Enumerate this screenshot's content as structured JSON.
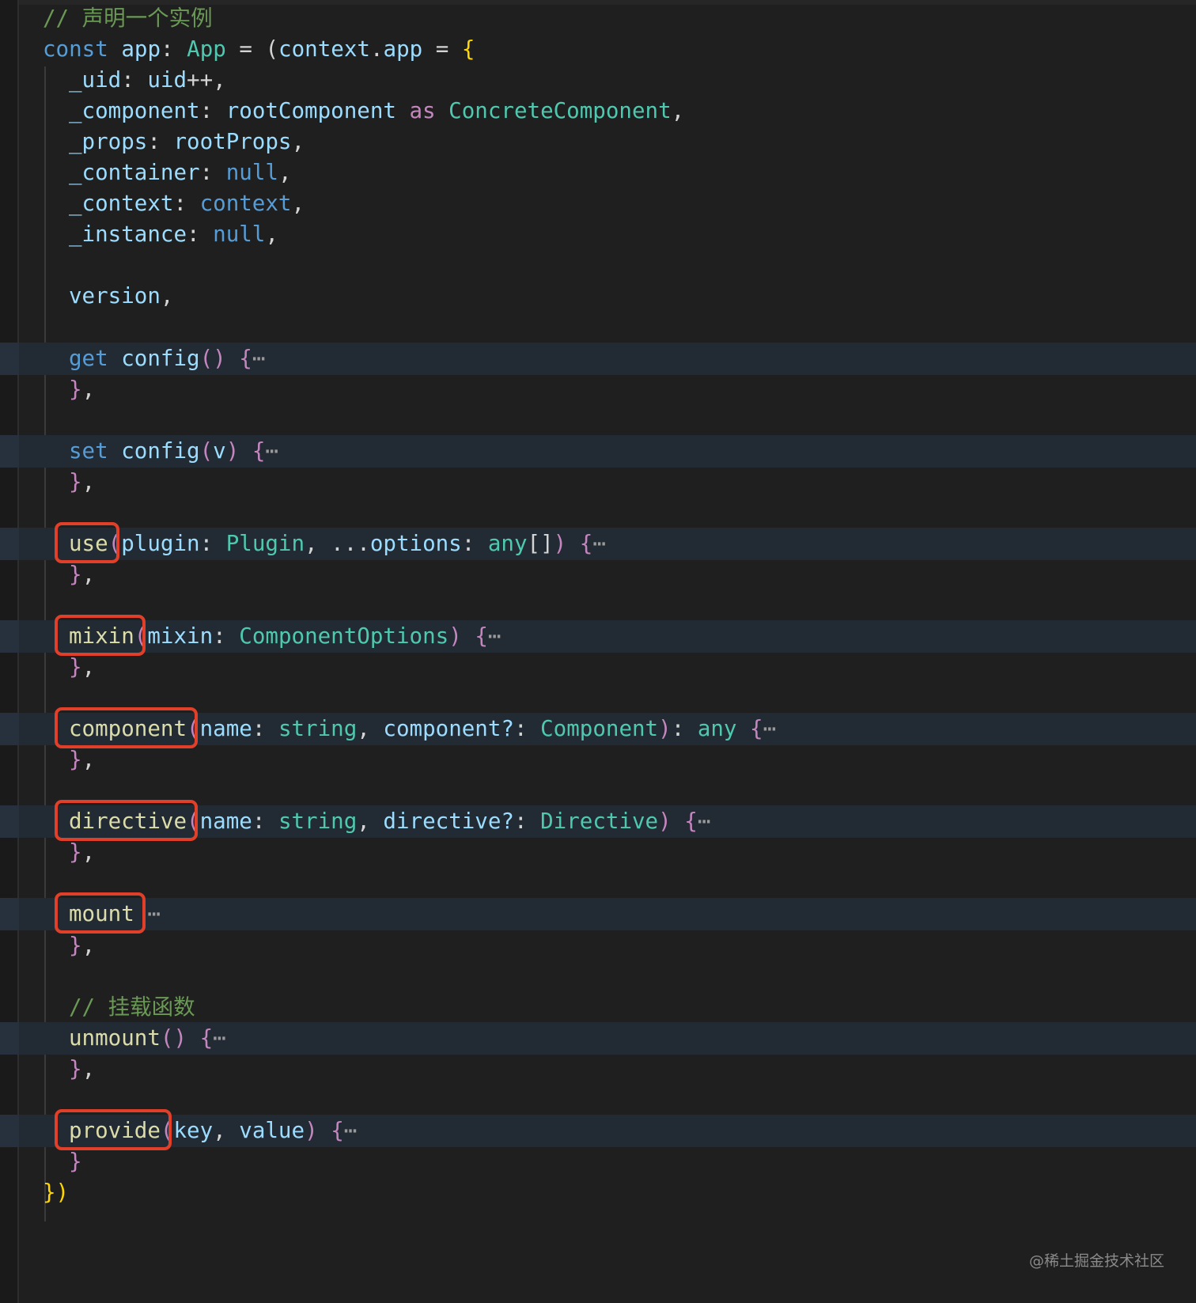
{
  "editor": {
    "lines": [
      {
        "highlight": false,
        "indent": 0,
        "tokens": [
          {
            "t": "// 声明一个实例",
            "c": "cm"
          }
        ]
      },
      {
        "highlight": false,
        "indent": 0,
        "tokens": [
          {
            "t": "const ",
            "c": "kw"
          },
          {
            "t": "app",
            "c": "var"
          },
          {
            "t": ": ",
            "c": "pl"
          },
          {
            "t": "App",
            "c": "ty"
          },
          {
            "t": " = ",
            "c": "pl"
          },
          {
            "t": "(",
            "c": "pl"
          },
          {
            "t": "context",
            "c": "var"
          },
          {
            "t": ".",
            "c": "pl"
          },
          {
            "t": "app",
            "c": "var"
          },
          {
            "t": " = ",
            "c": "pl"
          },
          {
            "t": "{",
            "c": "br"
          }
        ]
      },
      {
        "highlight": false,
        "indent": 1,
        "tokens": [
          {
            "t": "_uid",
            "c": "var"
          },
          {
            "t": ": ",
            "c": "pl"
          },
          {
            "t": "uid",
            "c": "var"
          },
          {
            "t": "++,",
            "c": "pl"
          }
        ]
      },
      {
        "highlight": false,
        "indent": 1,
        "tokens": [
          {
            "t": "_component",
            "c": "var"
          },
          {
            "t": ": ",
            "c": "pl"
          },
          {
            "t": "rootComponent",
            "c": "var"
          },
          {
            "t": " as ",
            "c": "pk"
          },
          {
            "t": "ConcreteComponent",
            "c": "ty"
          },
          {
            "t": ",",
            "c": "pl"
          }
        ]
      },
      {
        "highlight": false,
        "indent": 1,
        "tokens": [
          {
            "t": "_props",
            "c": "var"
          },
          {
            "t": ": ",
            "c": "pl"
          },
          {
            "t": "rootProps",
            "c": "var"
          },
          {
            "t": ",",
            "c": "pl"
          }
        ]
      },
      {
        "highlight": false,
        "indent": 1,
        "tokens": [
          {
            "t": "_container",
            "c": "var"
          },
          {
            "t": ": ",
            "c": "pl"
          },
          {
            "t": "null",
            "c": "kw"
          },
          {
            "t": ",",
            "c": "pl"
          }
        ]
      },
      {
        "highlight": false,
        "indent": 1,
        "tokens": [
          {
            "t": "_context",
            "c": "var"
          },
          {
            "t": ": ",
            "c": "pl"
          },
          {
            "t": "context",
            "c": "kw"
          },
          {
            "t": ",",
            "c": "pl"
          }
        ]
      },
      {
        "highlight": false,
        "indent": 1,
        "tokens": [
          {
            "t": "_instance",
            "c": "var"
          },
          {
            "t": ": ",
            "c": "pl"
          },
          {
            "t": "null",
            "c": "kw"
          },
          {
            "t": ",",
            "c": "pl"
          }
        ]
      },
      {
        "highlight": false,
        "indent": 1,
        "tokens": []
      },
      {
        "highlight": false,
        "indent": 1,
        "tokens": [
          {
            "t": "version",
            "c": "var"
          },
          {
            "t": ",",
            "c": "pl"
          }
        ]
      },
      {
        "highlight": false,
        "indent": 1,
        "tokens": []
      },
      {
        "highlight": true,
        "indent": 1,
        "tokens": [
          {
            "t": "get ",
            "c": "kw"
          },
          {
            "t": "config",
            "c": "var"
          },
          {
            "t": "()",
            "c": "pk"
          },
          {
            "t": " ",
            "c": "pl"
          },
          {
            "t": "{",
            "c": "pk"
          },
          {
            "t": "⋯",
            "c": "ellipsis"
          }
        ]
      },
      {
        "highlight": false,
        "indent": 1,
        "tokens": [
          {
            "t": "}",
            "c": "pk"
          },
          {
            "t": ",",
            "c": "pl"
          }
        ]
      },
      {
        "highlight": false,
        "indent": 1,
        "tokens": []
      },
      {
        "highlight": true,
        "indent": 1,
        "tokens": [
          {
            "t": "set ",
            "c": "kw"
          },
          {
            "t": "config",
            "c": "var"
          },
          {
            "t": "(",
            "c": "pk"
          },
          {
            "t": "v",
            "c": "var"
          },
          {
            "t": ")",
            "c": "pk"
          },
          {
            "t": " ",
            "c": "pl"
          },
          {
            "t": "{",
            "c": "pk"
          },
          {
            "t": "⋯",
            "c": "ellipsis"
          }
        ]
      },
      {
        "highlight": false,
        "indent": 1,
        "tokens": [
          {
            "t": "}",
            "c": "pk"
          },
          {
            "t": ",",
            "c": "pl"
          }
        ]
      },
      {
        "highlight": false,
        "indent": 1,
        "tokens": []
      },
      {
        "highlight": true,
        "indent": 1,
        "tokens": [
          {
            "t": "use",
            "c": "fn"
          },
          {
            "t": "(",
            "c": "pk"
          },
          {
            "t": "plugin",
            "c": "var"
          },
          {
            "t": ": ",
            "c": "pl"
          },
          {
            "t": "Plugin",
            "c": "ty"
          },
          {
            "t": ", ",
            "c": "pl"
          },
          {
            "t": "...",
            "c": "pl"
          },
          {
            "t": "options",
            "c": "var"
          },
          {
            "t": ": ",
            "c": "pl"
          },
          {
            "t": "any",
            "c": "ty"
          },
          {
            "t": "[]",
            "c": "pl"
          },
          {
            "t": ")",
            "c": "pk"
          },
          {
            "t": " ",
            "c": "pl"
          },
          {
            "t": "{",
            "c": "pk"
          },
          {
            "t": "⋯",
            "c": "ellipsis"
          }
        ]
      },
      {
        "highlight": false,
        "indent": 1,
        "tokens": [
          {
            "t": "}",
            "c": "pk"
          },
          {
            "t": ",",
            "c": "pl"
          }
        ]
      },
      {
        "highlight": false,
        "indent": 1,
        "tokens": []
      },
      {
        "highlight": true,
        "indent": 1,
        "tokens": [
          {
            "t": "mixin",
            "c": "fn"
          },
          {
            "t": "(",
            "c": "pk"
          },
          {
            "t": "mixin",
            "c": "var"
          },
          {
            "t": ": ",
            "c": "pl"
          },
          {
            "t": "ComponentOptions",
            "c": "ty"
          },
          {
            "t": ")",
            "c": "pk"
          },
          {
            "t": " ",
            "c": "pl"
          },
          {
            "t": "{",
            "c": "pk"
          },
          {
            "t": "⋯",
            "c": "ellipsis"
          }
        ]
      },
      {
        "highlight": false,
        "indent": 1,
        "tokens": [
          {
            "t": "}",
            "c": "pk"
          },
          {
            "t": ",",
            "c": "pl"
          }
        ]
      },
      {
        "highlight": false,
        "indent": 1,
        "tokens": []
      },
      {
        "highlight": true,
        "indent": 1,
        "tokens": [
          {
            "t": "component",
            "c": "fn"
          },
          {
            "t": "(",
            "c": "pk"
          },
          {
            "t": "name",
            "c": "var"
          },
          {
            "t": ": ",
            "c": "pl"
          },
          {
            "t": "string",
            "c": "ty"
          },
          {
            "t": ", ",
            "c": "pl"
          },
          {
            "t": "component?",
            "c": "var"
          },
          {
            "t": ": ",
            "c": "pl"
          },
          {
            "t": "Component",
            "c": "ty"
          },
          {
            "t": ")",
            "c": "pk"
          },
          {
            "t": ": ",
            "c": "pl"
          },
          {
            "t": "any",
            "c": "ty"
          },
          {
            "t": " ",
            "c": "pl"
          },
          {
            "t": "{",
            "c": "pk"
          },
          {
            "t": "⋯",
            "c": "ellipsis"
          }
        ]
      },
      {
        "highlight": false,
        "indent": 1,
        "tokens": [
          {
            "t": "}",
            "c": "pk"
          },
          {
            "t": ",",
            "c": "pl"
          }
        ]
      },
      {
        "highlight": false,
        "indent": 1,
        "tokens": []
      },
      {
        "highlight": true,
        "indent": 1,
        "tokens": [
          {
            "t": "directive",
            "c": "fn"
          },
          {
            "t": "(",
            "c": "pk"
          },
          {
            "t": "name",
            "c": "var"
          },
          {
            "t": ": ",
            "c": "pl"
          },
          {
            "t": "string",
            "c": "ty"
          },
          {
            "t": ", ",
            "c": "pl"
          },
          {
            "t": "directive?",
            "c": "var"
          },
          {
            "t": ": ",
            "c": "pl"
          },
          {
            "t": "Directive",
            "c": "ty"
          },
          {
            "t": ")",
            "c": "pk"
          },
          {
            "t": " ",
            "c": "pl"
          },
          {
            "t": "{",
            "c": "pk"
          },
          {
            "t": "⋯",
            "c": "ellipsis"
          }
        ]
      },
      {
        "highlight": false,
        "indent": 1,
        "tokens": [
          {
            "t": "}",
            "c": "pk"
          },
          {
            "t": ",",
            "c": "pl"
          }
        ]
      },
      {
        "highlight": false,
        "indent": 1,
        "tokens": []
      },
      {
        "highlight": true,
        "indent": 1,
        "tokens": [
          {
            "t": "mount",
            "c": "fn"
          },
          {
            "t": " ",
            "c": "pl"
          },
          {
            "t": "⋯",
            "c": "ellipsis"
          }
        ]
      },
      {
        "highlight": false,
        "indent": 1,
        "tokens": [
          {
            "t": "}",
            "c": "pk"
          },
          {
            "t": ",",
            "c": "pl"
          }
        ]
      },
      {
        "highlight": false,
        "indent": 1,
        "tokens": []
      },
      {
        "highlight": false,
        "indent": 1,
        "tokens": [
          {
            "t": "// 挂载函数",
            "c": "cm"
          }
        ]
      },
      {
        "highlight": true,
        "indent": 1,
        "tokens": [
          {
            "t": "unmount",
            "c": "fn"
          },
          {
            "t": "()",
            "c": "pk"
          },
          {
            "t": " ",
            "c": "pl"
          },
          {
            "t": "{",
            "c": "pk"
          },
          {
            "t": "⋯",
            "c": "ellipsis"
          }
        ]
      },
      {
        "highlight": false,
        "indent": 1,
        "tokens": [
          {
            "t": "}",
            "c": "pk"
          },
          {
            "t": ",",
            "c": "pl"
          }
        ]
      },
      {
        "highlight": false,
        "indent": 1,
        "tokens": []
      },
      {
        "highlight": true,
        "indent": 1,
        "tokens": [
          {
            "t": "provide",
            "c": "fn"
          },
          {
            "t": "(",
            "c": "pk"
          },
          {
            "t": "key",
            "c": "var"
          },
          {
            "t": ", ",
            "c": "pl"
          },
          {
            "t": "value",
            "c": "var"
          },
          {
            "t": ")",
            "c": "pk"
          },
          {
            "t": " ",
            "c": "pl"
          },
          {
            "t": "{",
            "c": "pk"
          },
          {
            "t": "⋯",
            "c": "ellipsis"
          }
        ]
      },
      {
        "highlight": false,
        "indent": 1,
        "tokens": [
          {
            "t": "}",
            "c": "pk"
          }
        ]
      },
      {
        "highlight": false,
        "indent": 0,
        "tokens": [
          {
            "t": "})",
            "c": "br"
          }
        ]
      }
    ],
    "annotated_methods": [
      "use",
      "mixin",
      "component",
      "directive",
      "mount",
      "provide"
    ],
    "annotation_color": "#e0402a"
  },
  "watermark": "@稀土掘金技术社区"
}
